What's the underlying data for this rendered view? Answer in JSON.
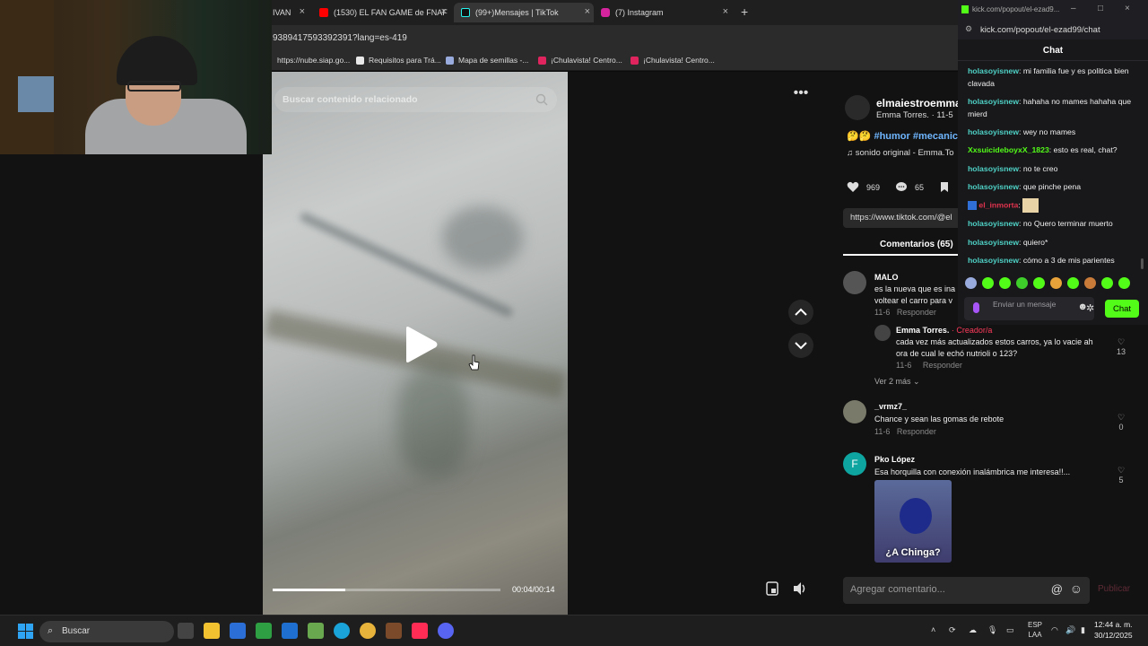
{
  "browser": {
    "tabs": [
      {
        "label": "IVAN"
      },
      {
        "label": "(1530) EL FAN GAME de FNAF"
      },
      {
        "label": "(99+)Mensajes | TikTok"
      },
      {
        "label": "(7) Instagram"
      }
    ],
    "url_fragment": "9389417593392391?lang=es-419",
    "bookmarks": [
      {
        "label": "https://nube.siap.go..."
      },
      {
        "label": "Requisitos para Trá..."
      },
      {
        "label": "Mapa de semillas -..."
      },
      {
        "label": "¡Chulavista! Centro..."
      },
      {
        "label": "¡Chulavista! Centro..."
      }
    ]
  },
  "video": {
    "search_placeholder": "Buscar contenido relacionado",
    "time": "00:04/00:14",
    "progress": 0.32
  },
  "post": {
    "author": "elmaiestroemma",
    "author_sub": "Emma Torres. · 11-5",
    "tags_emoji": "🤔🤔",
    "tag1": "#humor",
    "tag2": "#mecanica",
    "sound": "sonido original - Emma.To",
    "likes": "969",
    "comments": "65",
    "link": "https://www.tiktok.com/@el",
    "comments_tab": "Comentarios (65)",
    "add_comment_placeholder": "Agregar comentario...",
    "publish": "Publicar"
  },
  "comments": [
    {
      "name": "MALO",
      "text1": "es la nueva que es ina",
      "text2": "voltear el carro para v",
      "meta": "11-6",
      "reply": "Responder"
    },
    {
      "name": "Emma Torres.",
      "tag": "· Creador/a",
      "text1": "cada vez más actualizados estos carros, ya lo vacie ah",
      "text2": "ora de cual le echó nutrioli o 123?",
      "meta": "11-6",
      "reply": "Responder",
      "likes": "13"
    },
    {
      "more": "Ver 2 más"
    },
    {
      "name": "_vrmz7_",
      "text1": "Chance y sean las gomas de rebote",
      "meta": "11-6",
      "reply": "Responder",
      "likes": "0"
    },
    {
      "name": "Pko López",
      "text1": "Esa horquilla con conexión inalámbrica me interesa!!...",
      "likes": "5",
      "sticker_caption": "¿A Chinga?",
      "avatar_letter": "F"
    }
  ],
  "chat": {
    "window_url": "kick.com/popout/el-ezad9...",
    "address": "kick.com/popout/el-ezad99/chat",
    "title": "Chat",
    "messages": [
      {
        "user": "holasoyisnew",
        "text": "mi familia fue y es politica bien clavada",
        "color": "#4fd1c5"
      },
      {
        "user": "holasoyisnew",
        "text": "hahaha no mames hahaha que mierd",
        "color": "#4fd1c5"
      },
      {
        "user": "holasoyisnew",
        "text": "wey no mames",
        "color": "#4fd1c5"
      },
      {
        "user": "XxsuicideboyxX_1823",
        "text": "esto es real, chat?",
        "color": "#53fc18"
      },
      {
        "user": "holasoyisnew",
        "text": "no te creo",
        "color": "#4fd1c5"
      },
      {
        "user": "holasoyisnew",
        "text": "que pinche pena",
        "color": "#4fd1c5"
      },
      {
        "user": "el_inmorta",
        "text": "",
        "color": "#e2334d"
      },
      {
        "user": "holasoyisnew",
        "text": "no Quero terminar muerto",
        "color": "#4fd1c5"
      },
      {
        "user": "holasoyisnew",
        "text": "quiero*",
        "color": "#4fd1c5"
      },
      {
        "user": "holasoyisnew",
        "text": "cómo a 3 de mis parientes",
        "color": "#4fd1c5"
      }
    ],
    "input_placeholder": "Enviar un mensaje",
    "send_label": "Chat"
  },
  "taskbar": {
    "search": "Buscar",
    "lang1": "ESP",
    "lang2": "LAA",
    "time": "12:44 a. m.",
    "date": "30/12/2025"
  },
  "colors": {
    "kick_green": "#53fc18",
    "tiktok_bg": "#121212",
    "tag_blue": "#6fb6ff"
  }
}
